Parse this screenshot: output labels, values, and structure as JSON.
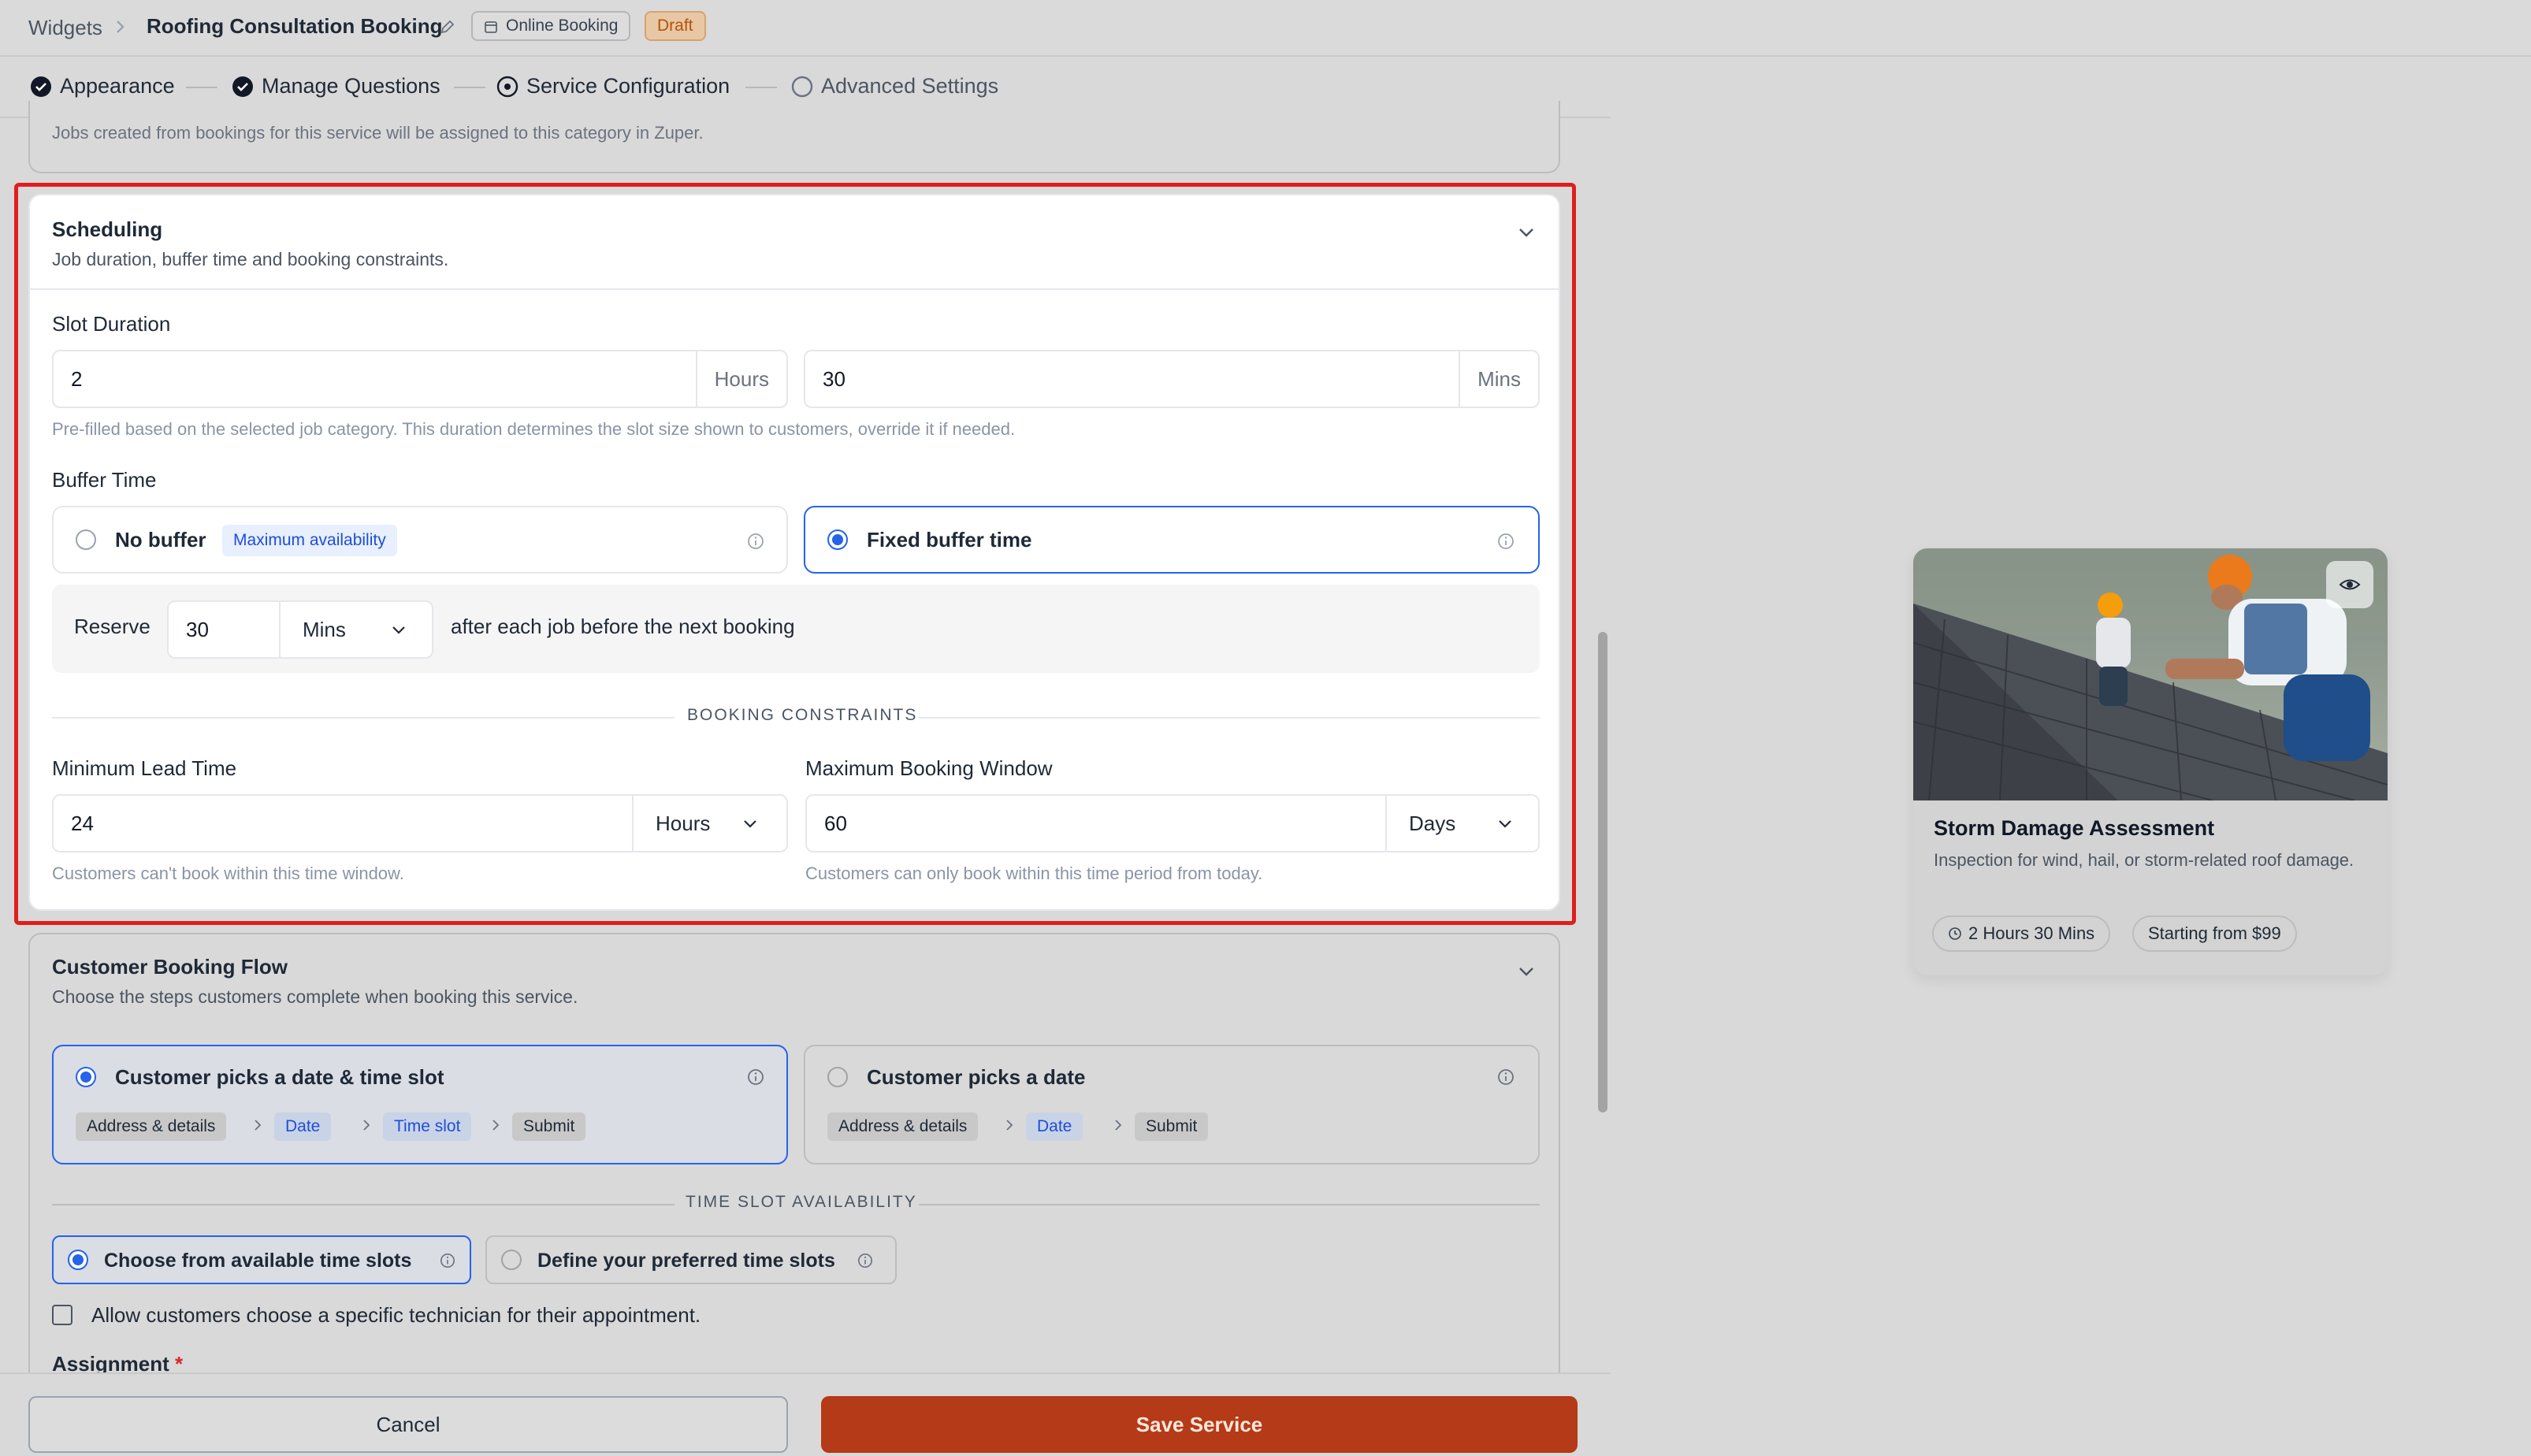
{
  "breadcrumb": {
    "root": "Widgets",
    "title": "Roofing Consultation Booking",
    "online_badge": "Online Booking",
    "status_badge": "Draft"
  },
  "steps": [
    {
      "label": "Appearance",
      "state": "done"
    },
    {
      "label": "Manage Questions",
      "state": "done"
    },
    {
      "label": "Service Configuration",
      "state": "current"
    },
    {
      "label": "Advanced Settings",
      "state": "pending"
    }
  ],
  "category_section": {
    "helper": "Jobs created from bookings for this service will be assigned to this category in Zuper."
  },
  "scheduling": {
    "title": "Scheduling",
    "subtitle": "Job duration, buffer time and booking constraints.",
    "slot_duration": {
      "label": "Slot Duration",
      "hours_value": "2",
      "hours_suffix": "Hours",
      "mins_value": "30",
      "mins_suffix": "Mins",
      "helper": "Pre-filled based on the selected job category. This duration determines the slot size shown to customers, override it if needed."
    },
    "buffer_time": {
      "label": "Buffer Time",
      "no_buffer_label": "No buffer",
      "no_buffer_badge": "Maximum availability",
      "fixed_label": "Fixed buffer time",
      "selected": "fixed",
      "reserve_label": "Reserve",
      "reserve_value": "30",
      "reserve_unit": "Mins",
      "reserve_suffix": "after each job before the next booking"
    },
    "constraints_heading": "BOOKING CONSTRAINTS",
    "min_lead": {
      "label": "Minimum Lead Time",
      "value": "24",
      "unit": "Hours",
      "helper": "Customers can't book within this time window."
    },
    "max_window": {
      "label": "Maximum Booking Window",
      "value": "60",
      "unit": "Days",
      "helper": "Customers can only book within this time period from today."
    }
  },
  "booking_flow": {
    "title": "Customer Booking Flow",
    "subtitle": "Choose the steps customers complete when booking this service.",
    "option_a": {
      "label": "Customer picks a date & time slot",
      "chips": [
        "Address & details",
        "Date",
        "Time slot",
        "Submit"
      ]
    },
    "option_b": {
      "label": "Customer picks a date",
      "chips": [
        "Address & details",
        "Date",
        "Submit"
      ]
    },
    "selected": "option_a",
    "availability_heading": "TIME SLOT AVAILABILITY",
    "avail_choose": "Choose from available time slots",
    "avail_define": "Define your preferred time slots",
    "technician_checkbox": "Allow customers choose a specific technician for their appointment.",
    "assignment_label": "Assignment",
    "assignment_required": "*"
  },
  "actions": {
    "cancel": "Cancel",
    "save": "Save Service"
  },
  "preview_card": {
    "title": "Storm Damage Assessment",
    "description": "Inspection for wind, hail, or storm-related roof damage.",
    "duration": "2 Hours 30 Mins",
    "price": "Starting from $99"
  },
  "colors": {
    "accent_blue": "#2563eb",
    "save_button": "#b53a17",
    "highlight_border": "#e11d1d",
    "draft_badge": "#b45309"
  }
}
